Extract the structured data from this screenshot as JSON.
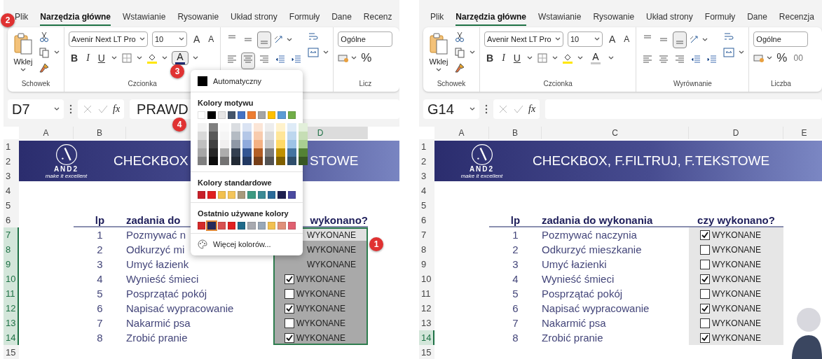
{
  "panes": [
    {
      "tabs": [
        {
          "label": "Plik",
          "selected": false
        },
        {
          "label": "Narzędzia główne",
          "selected": true
        },
        {
          "label": "Wstawianie",
          "selected": false
        },
        {
          "label": "Rysowanie",
          "selected": false
        },
        {
          "label": "Układ strony",
          "selected": false
        },
        {
          "label": "Formuły",
          "selected": false
        },
        {
          "label": "Dane",
          "selected": false
        },
        {
          "label": "Recenz",
          "selected": false
        }
      ],
      "ribbon": {
        "paste_label": "Wklej",
        "font": "Avenir Next LT Pro",
        "size": "10",
        "grow_glyph": "A",
        "shrink_glyph": "A",
        "format_glyphs": [
          "B",
          "I",
          "U"
        ],
        "font_color_button": {
          "glyph": "A",
          "color": "#1e2a6e",
          "open": true
        },
        "vertical_align": [
          {
            "selected": false
          },
          {
            "selected": false
          },
          {
            "selected": true
          }
        ],
        "horizontal_align": [
          {
            "selected": false
          },
          {
            "selected": true
          },
          {
            "selected": false
          },
          {
            "selected": false
          },
          {
            "selected": false
          }
        ],
        "number_format": "Ogólne",
        "percent_glyph": "%",
        "groups": [
          {
            "kind": "clipboard",
            "label": "Schowek"
          },
          {
            "kind": "font",
            "label": "Czcionka"
          },
          {
            "kind": "alignment"
          },
          {
            "kind": "number",
            "label": "Licz"
          }
        ]
      },
      "formula_bar": {
        "name_box": "D7",
        "function_label": "fx",
        "formula": "PRAWD"
      },
      "columns": [
        {
          "label": "A",
          "selected": false
        },
        {
          "label": "B",
          "selected": false
        },
        {
          "selected": false
        },
        {
          "label": "D",
          "selected": true
        }
      ],
      "rows": [
        {
          "label": "1",
          "selected": false
        },
        {
          "label": "2",
          "selected": false
        },
        {
          "label": "3",
          "selected": false
        },
        {
          "label": "4",
          "selected": false
        },
        {
          "label": "5",
          "selected": false
        },
        {
          "label": "6",
          "selected": false
        },
        {
          "label": "7",
          "selected": true
        },
        {
          "label": "8",
          "selected": true
        },
        {
          "label": "9",
          "selected": true
        },
        {
          "label": "10",
          "selected": true
        },
        {
          "label": "11",
          "selected": true
        },
        {
          "label": "12",
          "selected": true
        },
        {
          "label": "13",
          "selected": true
        },
        {
          "label": "14",
          "selected": true
        },
        {
          "label": "15",
          "selected": false
        }
      ],
      "banner": {
        "logo_text": "AND2",
        "tagline": "make it excellent",
        "title_parts": [
          "CHECKBOX",
          "STOWE"
        ]
      },
      "table": {
        "headers": [
          "lp",
          "zadania do",
          "wykonano?"
        ],
        "range_selected": true,
        "rows": [
          {
            "lp": "1",
            "task": "Pozmywać n",
            "status": "WYKONANE"
          },
          {
            "lp": "2",
            "task": "Odkurzyć mi",
            "status": "WYKONANE"
          },
          {
            "lp": "3",
            "task": "Umyć łazienk",
            "status": "WYKONANE"
          },
          {
            "lp": "4",
            "task": "Wynieść śmieci",
            "checked": true,
            "status": "WYKONANE"
          },
          {
            "lp": "5",
            "task": "Posprzątać pokój",
            "checked": false,
            "status": "WYKONANE"
          },
          {
            "lp": "6",
            "task": "Napisać wypracowanie",
            "checked": true,
            "status": "WYKONANE"
          },
          {
            "lp": "7",
            "task": "Nakarmić psa",
            "checked": false,
            "status": "WYKONANE"
          },
          {
            "lp": "8",
            "task": "Zrobić pranie",
            "checked": true,
            "status": "WYKONANE"
          }
        ]
      }
    },
    {
      "tabs": [
        {
          "label": "Plik",
          "selected": false
        },
        {
          "label": "Narzędzia główne",
          "selected": true
        },
        {
          "label": "Wstawianie",
          "selected": false
        },
        {
          "label": "Rysowanie",
          "selected": false
        },
        {
          "label": "Układ strony",
          "selected": false
        },
        {
          "label": "Formuły",
          "selected": false
        },
        {
          "label": "Dane",
          "selected": false
        },
        {
          "label": "Recenzja",
          "selected": false
        }
      ],
      "ribbon": {
        "paste_label": "Wklej",
        "font": "Avenir Next LT Pro",
        "size": "10",
        "grow_glyph": "A",
        "shrink_glyph": "A",
        "format_glyphs": [
          "B",
          "I",
          "U"
        ],
        "font_color_button": {
          "glyph": "A",
          "color": "#c8c8c8",
          "open": false
        },
        "vertical_align": [
          {
            "selected": false
          },
          {
            "selected": false
          },
          {
            "selected": true
          }
        ],
        "horizontal_align": [
          {
            "selected": false
          },
          {
            "selected": false
          },
          {
            "selected": false
          },
          {
            "selected": false
          },
          {
            "selected": false
          }
        ],
        "number_format": "Ogólne",
        "percent_glyph": "%",
        "thousands_glyph": "00",
        "groups": [
          {
            "kind": "clipboard",
            "label": "Schowek"
          },
          {
            "kind": "font",
            "label": "Czcionka"
          },
          {
            "kind": "alignment",
            "label": "Wyrównanie"
          },
          {
            "kind": "number",
            "label": "Liczba"
          }
        ]
      },
      "formula_bar": {
        "name_box": "G14",
        "function_label": "fx"
      },
      "columns": [
        {
          "label": "A",
          "selected": false
        },
        {
          "label": "B",
          "selected": false
        },
        {
          "label": "C",
          "selected": false
        },
        {
          "label": "D",
          "selected": false
        },
        {
          "label": "E",
          "selected": false
        }
      ],
      "rows": [
        {
          "label": "1",
          "selected": false
        },
        {
          "label": "2",
          "selected": false
        },
        {
          "label": "3",
          "selected": false
        },
        {
          "label": "4",
          "selected": false
        },
        {
          "label": "5",
          "selected": false
        },
        {
          "label": "6",
          "selected": false
        },
        {
          "label": "7",
          "selected": false
        },
        {
          "label": "8",
          "selected": false
        },
        {
          "label": "9",
          "selected": false
        },
        {
          "label": "10",
          "selected": false
        },
        {
          "label": "11",
          "selected": false
        },
        {
          "label": "12",
          "selected": false
        },
        {
          "label": "13",
          "selected": false
        },
        {
          "label": "14",
          "selected": true
        },
        {
          "label": "15",
          "selected": false
        }
      ],
      "banner": {
        "logo_text": "AND2",
        "tagline": "make it excellent",
        "title_parts": [
          "CHECKBOX, F.FILTRUJ, F.TEKSTOWE"
        ]
      },
      "table": {
        "headers": [
          "lp",
          "zadania do wykonania",
          "czy wykonano?"
        ],
        "range_selected": false,
        "rows": [
          {
            "lp": "1",
            "task": "Pozmywać naczynia",
            "checked": true,
            "status": "WYKONANE"
          },
          {
            "lp": "2",
            "task": "Odkurzyć mieszkanie",
            "checked": false,
            "status": "WYKONANE"
          },
          {
            "lp": "3",
            "task": "Umyć łazienki",
            "checked": false,
            "status": "WYKONANE"
          },
          {
            "lp": "4",
            "task": "Wynieść śmieci",
            "checked": true,
            "status": "WYKONANE"
          },
          {
            "lp": "5",
            "task": "Posprzątać pokój",
            "checked": false,
            "status": "WYKONANE"
          },
          {
            "lp": "6",
            "task": "Napisać wypracowanie",
            "checked": true,
            "status": "WYKONANE"
          },
          {
            "lp": "7",
            "task": "Nakarmić psa",
            "checked": false,
            "status": "WYKONANE"
          },
          {
            "lp": "8",
            "task": "Zrobić pranie",
            "checked": true,
            "status": "WYKONANE"
          }
        ]
      }
    }
  ],
  "color_menu": {
    "automatic_label": "Automatyczny",
    "theme_heading": "Kolory motywu",
    "theme_colors": [
      {
        "color": "#ffffff"
      },
      {
        "color": "#000000"
      },
      {
        "color": "#e7e6e6"
      },
      {
        "color": "#44546a"
      },
      {
        "color": "#4472c4"
      },
      {
        "color": "#ed7d31"
      },
      {
        "color": "#a5a5a5"
      },
      {
        "color": "#ffc000"
      },
      {
        "color": "#5b9bd5"
      },
      {
        "color": "#70ad47"
      }
    ],
    "standard_heading": "Kolory standardowe",
    "standard_colors": [
      {
        "color": "#c8202a"
      },
      {
        "color": "#e02020"
      },
      {
        "color": "#f2c14e"
      },
      {
        "color": "#f4c55a"
      },
      {
        "color": "#a89a7c"
      },
      {
        "color": "#3c9a82"
      },
      {
        "color": "#3a8a96"
      },
      {
        "color": "#2a6a9a"
      },
      {
        "color": "#1e2050"
      },
      {
        "color": "#4a4aa0"
      }
    ],
    "recent_heading": "Ostatnio używane kolory",
    "recent_colors": [
      {
        "color": "#d42a2a",
        "selected": false
      },
      {
        "color": "#262a5a",
        "selected": true
      },
      {
        "color": "#d85050",
        "selected": false
      },
      {
        "color": "#e02020",
        "selected": false
      },
      {
        "color": "#1e6a8a",
        "selected": false
      },
      {
        "color": "#a8aab0",
        "selected": false
      },
      {
        "color": "#98a8b8",
        "selected": false
      },
      {
        "color": "#f2c050",
        "selected": false
      },
      {
        "color": "#e0907a",
        "selected": false
      },
      {
        "color": "#e06070",
        "selected": false
      }
    ],
    "more_label": "Więcej kolorów..."
  },
  "callouts": [
    {
      "label": "1"
    },
    {
      "label": "2"
    },
    {
      "label": "3"
    },
    {
      "label": "4"
    }
  ]
}
